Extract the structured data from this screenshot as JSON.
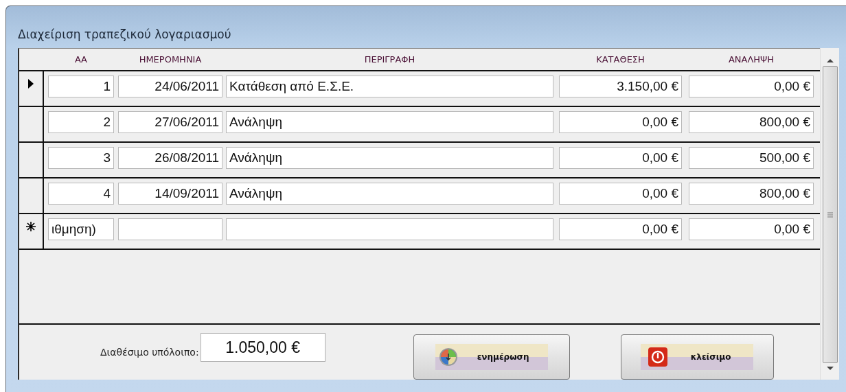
{
  "window": {
    "title": "Διαχείριση τραπεζικού λογαριασμού"
  },
  "table": {
    "columns": [
      "ΑΑ",
      "ΗΜΕΡΟΜΗΝΙΑ",
      "ΠΕΡΙΓΡΑΦΗ",
      "ΚΑΤΑΘΕΣΗ",
      "ΑΝΑΛΗΨΗ"
    ],
    "rows": [
      {
        "kind": "record",
        "selected": true,
        "cells": [
          "1",
          "24/06/2011",
          "Κατάθεση από Ε.Σ.Ε.",
          "3.150,00 €",
          "0,00 €"
        ]
      },
      {
        "kind": "record",
        "selected": false,
        "cells": [
          "2",
          "27/06/2011",
          "Ανάληψη",
          "0,00 €",
          "800,00 €"
        ]
      },
      {
        "kind": "record",
        "selected": false,
        "cells": [
          "3",
          "26/08/2011",
          "Ανάληψη",
          "0,00 €",
          "500,00 €"
        ]
      },
      {
        "kind": "record",
        "selected": false,
        "cells": [
          "4",
          "14/09/2011",
          "Ανάληψη",
          "0,00 €",
          "800,00 €"
        ]
      },
      {
        "kind": "new",
        "selected": false,
        "cells": [
          "ιθμηση)",
          null,
          null,
          "0,00 €",
          "0,00 €"
        ]
      }
    ]
  },
  "footer": {
    "balance_label": "Διαθέσιμο υπόλοιπο:",
    "balance": "1.050,00 €"
  },
  "buttons": [
    {
      "kind": "update",
      "label": "ενημέρωση"
    },
    {
      "kind": "close",
      "label": "κλείσιμο"
    }
  ]
}
